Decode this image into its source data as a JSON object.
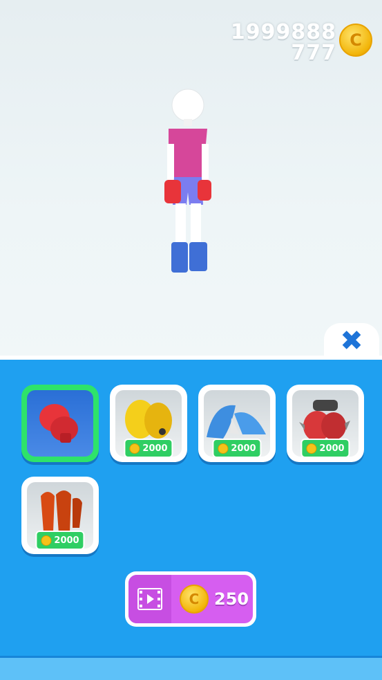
{
  "wallet": {
    "line1": "1999888",
    "line2": "777",
    "coin_glyph": "C"
  },
  "character": {
    "skin": "#ffffff",
    "shirt": "#d6479a",
    "shorts": "#7b7df0",
    "gloves": "#e8343a",
    "shoes": "#3f6fd6"
  },
  "close_button": {
    "icon": "close-icon",
    "glyph": "✖"
  },
  "items": [
    {
      "name": "red-boxing-gloves",
      "selected": true,
      "price": null
    },
    {
      "name": "yellow-paws",
      "selected": false,
      "price": "2000"
    },
    {
      "name": "shark-gloves",
      "selected": false,
      "price": "2000"
    },
    {
      "name": "spiked-red-gloves",
      "selected": false,
      "price": "2000"
    },
    {
      "name": "orange-claws",
      "selected": false,
      "price": "2000"
    }
  ],
  "ad_button": {
    "icon": "video-icon",
    "coin_glyph": "C",
    "reward": "250"
  },
  "colors": {
    "panel": "#1fa0f0",
    "select": "#2ee36a",
    "price_tag": "#2fce63",
    "ad": "#d65ef0"
  }
}
